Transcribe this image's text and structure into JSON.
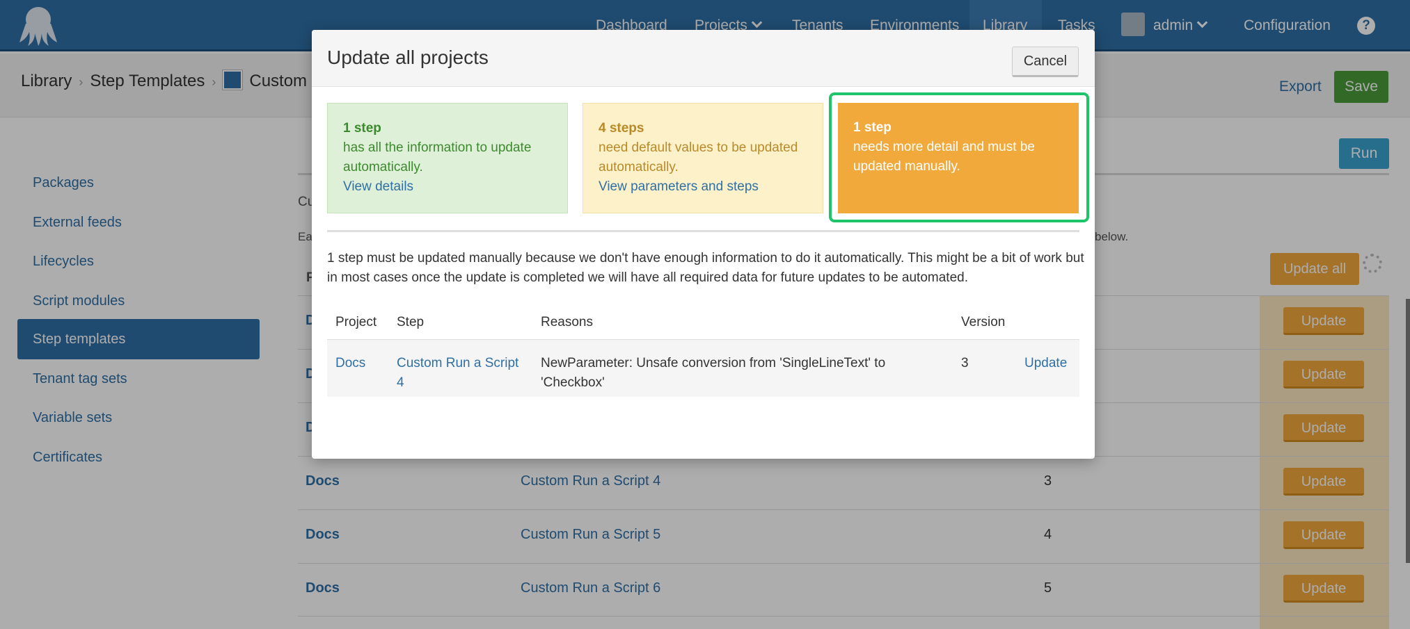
{
  "nav": {
    "items": [
      {
        "label": "Dashboard"
      },
      {
        "label": "Projects"
      },
      {
        "label": "Tenants"
      },
      {
        "label": "Environments"
      },
      {
        "label": "Library"
      },
      {
        "label": "Tasks"
      },
      {
        "label": "admin"
      },
      {
        "label": "Configuration"
      }
    ],
    "help_label": "?"
  },
  "breadcrumb": {
    "items": [
      "Library",
      "Step Templates",
      "Custom"
    ],
    "sep": "›"
  },
  "header": {
    "export_label": "Export",
    "save_label": "Save"
  },
  "sidebar": {
    "items": [
      {
        "label": "Packages"
      },
      {
        "label": "External feeds"
      },
      {
        "label": "Lifecycles"
      },
      {
        "label": "Script modules"
      },
      {
        "label": "Step templates"
      },
      {
        "label": "Tenant tag sets"
      },
      {
        "label": "Variable sets"
      },
      {
        "label": "Certificates"
      }
    ]
  },
  "main": {
    "run_label": "Run",
    "frag_cu": "Cu",
    "frag_ea": "Ea",
    "frag_below": "below.",
    "frag_p": "P",
    "frag_d": "D",
    "update_all_label": "Update all",
    "update_label": "Update",
    "rows": [
      {
        "project": "Docs",
        "step": "Custom Run a Script 4",
        "version": "3"
      },
      {
        "project": "Docs",
        "step": "Custom Run a Script 5",
        "version": "4"
      },
      {
        "project": "Docs",
        "step": "Custom Run a Script 6",
        "version": "5"
      }
    ]
  },
  "modal": {
    "title": "Update all projects",
    "cancel_label": "Cancel",
    "cards": {
      "green": {
        "count": "1 step",
        "text": "has all the information to update automatically.",
        "link": "View details"
      },
      "yellow": {
        "count": "4 steps",
        "text": "need default values to be updated automatically.",
        "link": "View parameters and steps"
      },
      "orange": {
        "count": "1 step",
        "text": "needs more detail and must be updated manually."
      }
    },
    "description": "1 step must be updated manually because we don't have enough information to do it automatically. This might be a bit of work but in most cases once the update is completed we will have all required data for future updates to be automated.",
    "table": {
      "headers": [
        "Project",
        "Step",
        "Reasons",
        "Version"
      ],
      "row": {
        "project": "Docs",
        "step": "Custom Run a Script 4",
        "reason": "NewParameter: Unsafe conversion from 'SingleLineText' to 'Checkbox'",
        "version": "3",
        "action": "Update"
      }
    }
  },
  "colors": {
    "nav_bg": "#2f6fa5",
    "success": "#4c9b3a",
    "warning": "#f2a93b",
    "highlight": "#1ec46a"
  }
}
